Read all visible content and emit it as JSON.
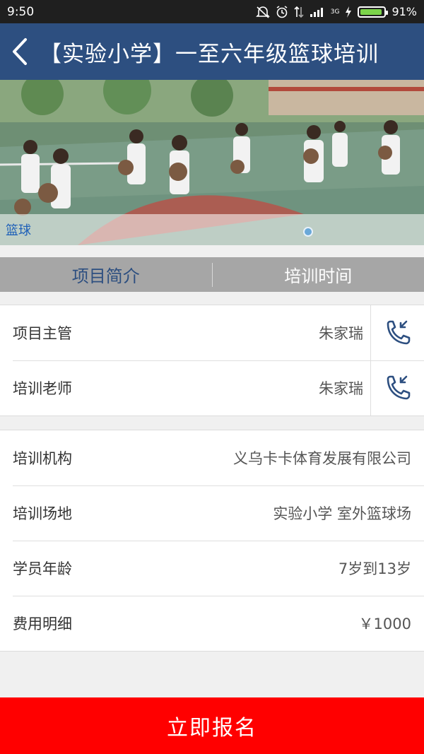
{
  "status_bar": {
    "time": "9:50",
    "battery": "91%",
    "battery_level": 0.91,
    "network_label": "3G"
  },
  "app_bar": {
    "title": "【实验小学】一至六年级篮球培训"
  },
  "banner": {
    "caption": "篮球",
    "image_description_icon": "basketball-photo"
  },
  "tabs": [
    {
      "label": "项目简介",
      "active": true
    },
    {
      "label": "培训时间",
      "active": false
    }
  ],
  "contacts": [
    {
      "label": "项目主管",
      "value": "朱家瑞"
    },
    {
      "label": "培训老师",
      "value": "朱家瑞"
    }
  ],
  "details": [
    {
      "label": "培训机构",
      "value": "义乌卡卡体育发展有限公司"
    },
    {
      "label": "培训场地",
      "value": "实验小学 室外篮球场"
    },
    {
      "label": "学员年龄",
      "value": "7岁到13岁"
    },
    {
      "label": "费用明细",
      "value": "￥1000"
    }
  ],
  "submit": {
    "label": "立即报名"
  },
  "colors": {
    "app_bar": "#2d4f80",
    "tab_bar": "#a6a6a6",
    "submit": "#ff0000",
    "call_icon": "#2d4f80"
  }
}
